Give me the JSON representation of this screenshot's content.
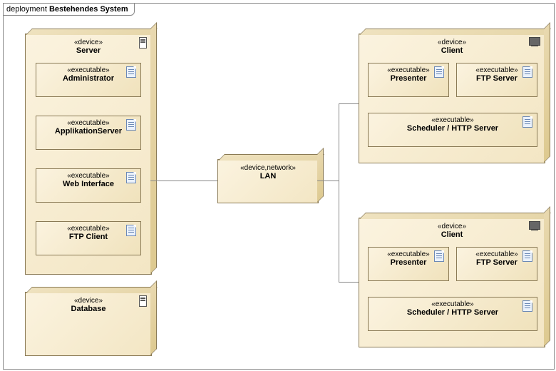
{
  "frame": {
    "label_prefix": "deployment ",
    "label_name": "Bestehendes System"
  },
  "stereotypes": {
    "device": "«device»",
    "executable": "«executable»",
    "device_network": "«device,network»"
  },
  "server": {
    "name": "Server",
    "administrator": "Administrator",
    "app_server": "ApplikationServer",
    "web_interface": "Web Interface",
    "ftp_client": "FTP Client"
  },
  "database": {
    "name": "Database"
  },
  "lan": {
    "name": "LAN"
  },
  "client1": {
    "name": "Client",
    "presenter": "Presenter",
    "ftp_server": "FTP Server",
    "scheduler": "Scheduler / HTTP Server"
  },
  "client2": {
    "name": "Client",
    "presenter": "Presenter",
    "ftp_server": "FTP Server",
    "scheduler": "Scheduler / HTTP Server"
  }
}
